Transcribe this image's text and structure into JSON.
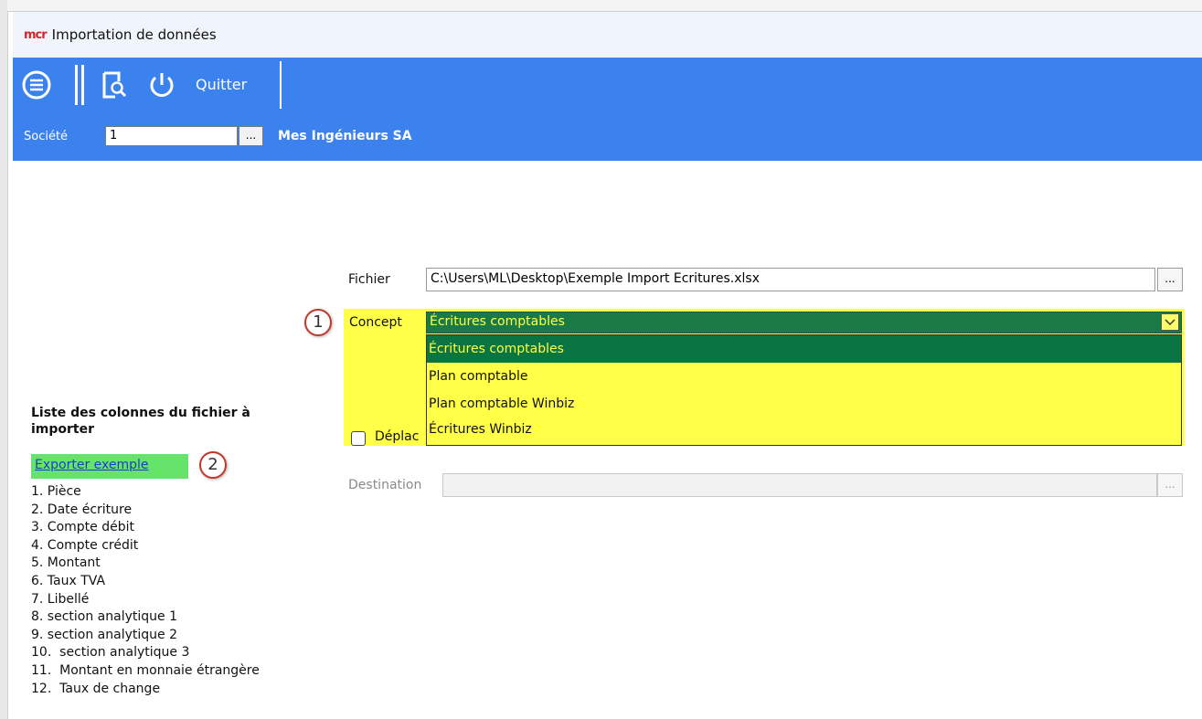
{
  "window": {
    "logo": "mcr",
    "title": "Importation de données"
  },
  "toolbar": {
    "quit_label": "Quitter",
    "icons": [
      "menu-icon",
      "preview-icon",
      "power-icon"
    ],
    "societe_label": "Société",
    "societe_value": "1",
    "browse_label": "...",
    "societe_name": "Mes Ingénieurs SA"
  },
  "form": {
    "fichier_label": "Fichier",
    "fichier_value": "C:\\Users\\ML\\Desktop\\Exemple Import Ecritures.xlsx",
    "fichier_browse": "...",
    "concept_label": "Concept",
    "concept_value": "Écritures comptables",
    "concept_options": [
      "Écritures comptables",
      "Plan comptable",
      "Plan comptable Winbiz",
      "Écritures Winbiz"
    ],
    "checkbox_label": "Déplac",
    "destination_label": "Destination",
    "destination_value": "",
    "destination_browse": "..."
  },
  "annotations": {
    "badge_1": "1",
    "badge_2": "2"
  },
  "colors": {
    "toolbar": "#3b82ee",
    "highlight": "#ffff47",
    "selected": "#0a7442",
    "export_highlight": "#66e36a",
    "badge_border": "#c0392b"
  },
  "columns": {
    "title": "Liste des colonnes du fichier à importer",
    "export_link": "Exporter exemple",
    "items": [
      "1. Pièce",
      "2. Date écriture",
      "3. Compte débit",
      "4. Compte crédit",
      "5. Montant",
      "6. Taux TVA",
      "7. Libellé",
      "8. section analytique 1",
      "9. section analytique 2",
      "10.  section analytique 3",
      "11.  Montant en monnaie étrangère",
      "12.  Taux de change"
    ]
  }
}
